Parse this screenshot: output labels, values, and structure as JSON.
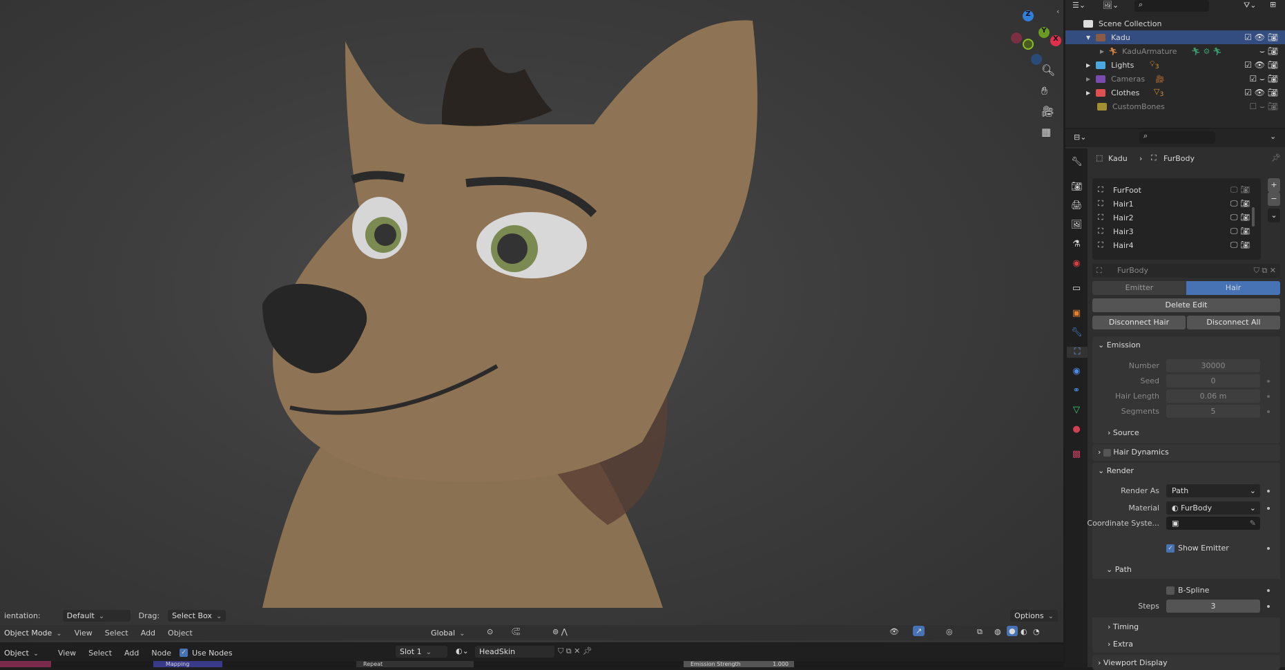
{
  "viewport": {
    "tool_settings": {
      "orientation_label": "ientation:",
      "orientation_value": "Default",
      "drag_label": "Drag:",
      "drag_value": "Select Box",
      "options": "Options"
    },
    "header": {
      "mode": "Object Mode",
      "menus": [
        "View",
        "Select",
        "Add",
        "Object"
      ],
      "transform_orientation": "Global"
    },
    "gizmo": {
      "axes": [
        "Z",
        "Y",
        "X"
      ]
    },
    "nav_buttons": [
      "zoom-icon",
      "hand-pan-icon",
      "camera-icon",
      "grid-ortho-icon"
    ]
  },
  "node_editor": {
    "mode": "Object",
    "menus": [
      "View",
      "Select",
      "Add",
      "Node"
    ],
    "use_nodes": "Use Nodes",
    "slot": "Slot 1",
    "material": "HeadSkin",
    "node_fragments": [
      "Mapping",
      "Repeat",
      "Emission Strength",
      "1.000"
    ]
  },
  "outliner": {
    "title": "Scene Collection",
    "items": [
      {
        "name": "Kadu",
        "color": "#8a5a44",
        "selected": true
      },
      {
        "name": "KaduArmature",
        "color": "#d08040",
        "dim": true
      },
      {
        "name": "Lights",
        "color": "#4aa8e0",
        "badge": "3"
      },
      {
        "name": "Cameras",
        "color": "#7a4ab0",
        "dim": true
      },
      {
        "name": "Clothes",
        "color": "#e05050",
        "badge": "3"
      },
      {
        "name": "CustomBones",
        "color": "#a09030",
        "dim": true
      }
    ]
  },
  "properties": {
    "breadcrumb": [
      "Kadu",
      "FurBody"
    ],
    "particle_systems": [
      "FurFoot",
      "Hair1",
      "Hair2",
      "Hair3",
      "Hair4"
    ],
    "settings_name": "FurBody",
    "type_tabs": [
      "Emitter",
      "Hair"
    ],
    "active_type": "Hair",
    "delete_edit": "Delete Edit",
    "disconnect_hair": "Disconnect Hair",
    "disconnect_all": "Disconnect All",
    "emission": {
      "title": "Emission",
      "number_label": "Number",
      "number": "30000",
      "seed_label": "Seed",
      "seed": "0",
      "hair_length_label": "Hair Length",
      "hair_length": "0.06 m",
      "segments_label": "Segments",
      "segments": "5",
      "source": "Source"
    },
    "hair_dynamics": "Hair Dynamics",
    "render": {
      "title": "Render",
      "render_as_label": "Render As",
      "render_as": "Path",
      "material_label": "Material",
      "material": "FurBody",
      "coord_label": "Coordinate Syste...",
      "show_emitter": "Show Emitter",
      "path": "Path",
      "bspline": "B-Spline",
      "steps_label": "Steps",
      "steps": "3",
      "timing": "Timing",
      "extra": "Extra"
    },
    "viewport_display": "Viewport Display"
  },
  "colors": {
    "accent": "#4772b3",
    "selected_row": "#334d80"
  }
}
